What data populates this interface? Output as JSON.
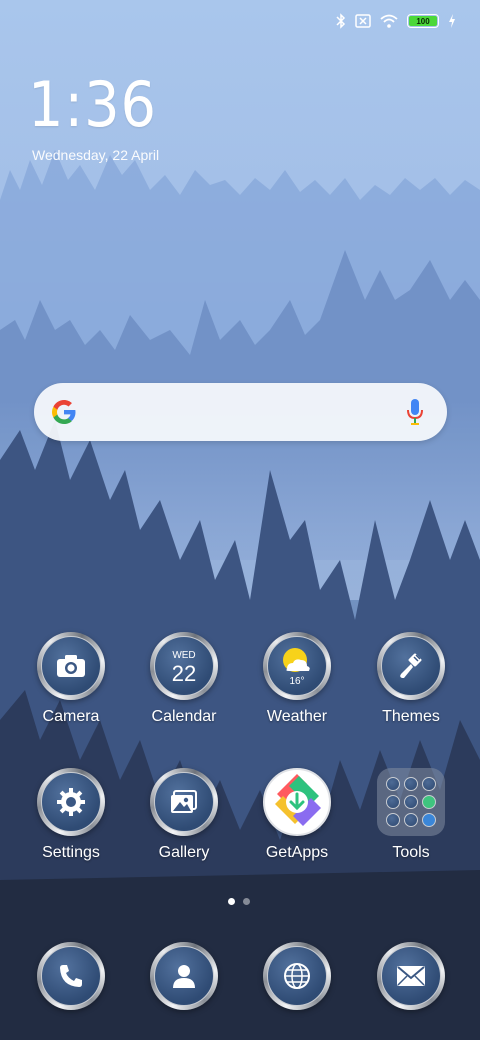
{
  "status": {
    "battery_level": "100"
  },
  "clock": {
    "time": "1:36",
    "date": "Wednesday, 22 April"
  },
  "search": {
    "provider": "Google"
  },
  "apps_row1": [
    {
      "label": "Camera"
    },
    {
      "label": "Calendar",
      "day_abbr": "WED",
      "day_num": "22"
    },
    {
      "label": "Weather",
      "temp": "16°"
    },
    {
      "label": "Themes"
    }
  ],
  "apps_row2": [
    {
      "label": "Settings"
    },
    {
      "label": "Gallery"
    },
    {
      "label": "GetApps"
    },
    {
      "label": "Tools"
    }
  ],
  "dock": [
    {
      "icon": "phone-icon"
    },
    {
      "icon": "contacts-icon"
    },
    {
      "icon": "browser-icon"
    },
    {
      "icon": "messaging-icon"
    }
  ],
  "page_indicator": {
    "pages": 2,
    "current": 1
  },
  "colors": {
    "sky": "#a9c6ec",
    "battery_green": "#4cd83a",
    "icon_inner": "#2f4b74"
  }
}
